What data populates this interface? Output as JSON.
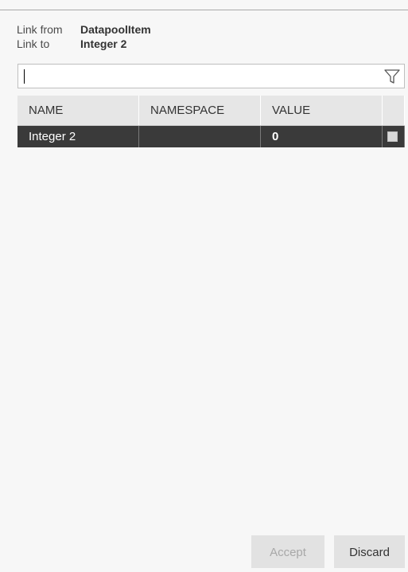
{
  "link": {
    "from_label": "Link from",
    "from_value": "DatapoolItem",
    "to_label": "Link to",
    "to_value": "Integer 2"
  },
  "search": {
    "value": "",
    "placeholder": ""
  },
  "table": {
    "columns": [
      "NAME",
      "NAMESPACE",
      "VALUE",
      ""
    ],
    "rows": [
      {
        "name": "Integer 2",
        "namespace": "",
        "value": "0",
        "checked": false
      }
    ]
  },
  "buttons": {
    "accept_label": "Accept",
    "discard_label": "Discard"
  },
  "colors": {
    "selected_row": "#3a3a3a",
    "header_bg": "#e6e6e6",
    "button_bg": "#e2e2e2"
  },
  "icons": {
    "filter": "filter-icon"
  }
}
